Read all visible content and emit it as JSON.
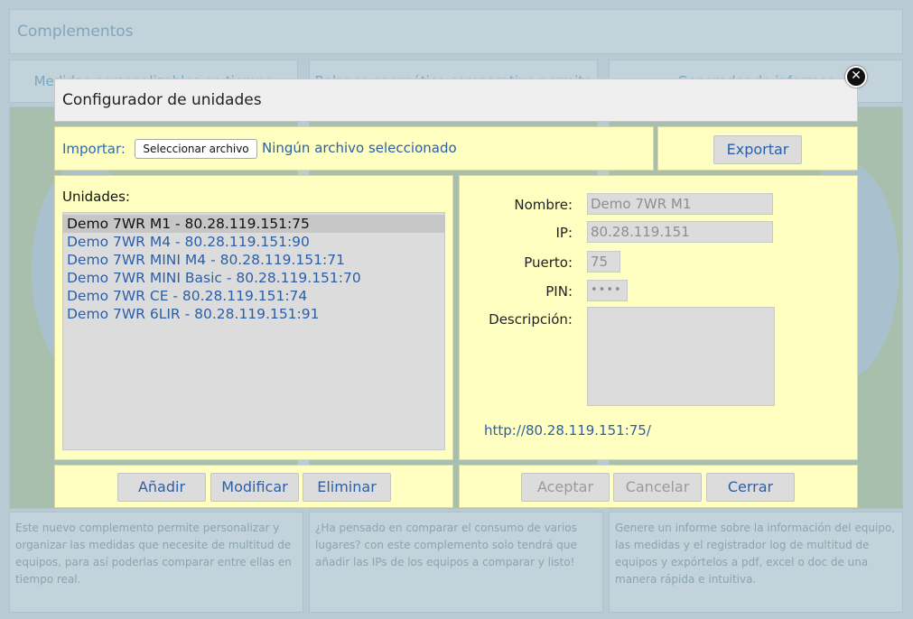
{
  "background": {
    "header_title": "Complementos",
    "cards": [
      {
        "title": "Medidas personalizables en tiempo",
        "desc": "Este nuevo complemento permite personalizar y organizar las medidas que necesite de multitud de equipos, para así poderlas comparar entre ellas en tiempo real."
      },
      {
        "title": "Balance energético comparativo permite",
        "desc": "¿Ha pensado en comparar el consumo de varios lugares? con este complemento solo tendrá que añadir las IPs de los equipos a comparar y listo!"
      },
      {
        "title": "Generador de informes",
        "desc": "Genere un informe sobre la información del equipo, las medidas y el registrador log de multitud de equipos y expórtelos a pdf, excel o doc de una manera rápida e intuitiva."
      }
    ]
  },
  "modal": {
    "title": "Configurador de unidades",
    "close_symbol": "✕",
    "import": {
      "label": "Importar:",
      "file_button": "Seleccionar archivo",
      "file_status": "Ningún archivo seleccionado"
    },
    "export_label": "Exportar",
    "units_label": "Unidades:",
    "units": [
      {
        "text": "Demo 7WR M1 - 80.28.119.151:75",
        "selected": true
      },
      {
        "text": "Demo 7WR M4 - 80.28.119.151:90",
        "selected": false
      },
      {
        "text": "Demo 7WR MINI M4 - 80.28.119.151:71",
        "selected": false
      },
      {
        "text": "Demo 7WR MINI Basic - 80.28.119.151:70",
        "selected": false
      },
      {
        "text": "Demo 7WR CE - 80.28.119.151:74",
        "selected": false
      },
      {
        "text": "Demo 7WR 6LIR - 80.28.119.151:91",
        "selected": false
      }
    ],
    "form": {
      "name_label": "Nombre:",
      "name_value": "Demo 7WR M1",
      "ip_label": "IP:",
      "ip_value": "80.28.119.151",
      "port_label": "Puerto:",
      "port_value": "75",
      "pin_label": "PIN:",
      "pin_value": "••••",
      "desc_label": "Descripción:",
      "desc_value": "",
      "url": "http://80.28.119.151:75/"
    },
    "actions_left": {
      "add": "Añadir",
      "modify": "Modificar",
      "delete": "Eliminar"
    },
    "actions_right": {
      "accept": "Aceptar",
      "cancel": "Cancelar",
      "close": "Cerrar"
    }
  }
}
